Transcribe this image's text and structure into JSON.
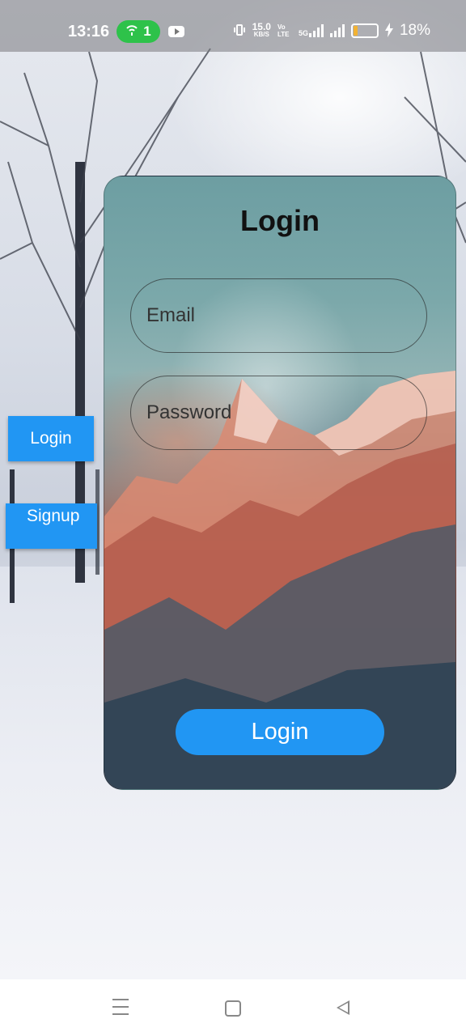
{
  "status_bar": {
    "time": "13:16",
    "hotspot_count": "1",
    "speed_value": "15.0",
    "speed_unit": "KB/S",
    "volte": "Vo LTE",
    "network": "5G",
    "battery_percent": "18%",
    "battery_level": 0.18
  },
  "side_buttons": {
    "login_label": "Login",
    "signup_label": "Signup"
  },
  "card": {
    "title": "Login",
    "email_placeholder": "Email",
    "password_placeholder": "Password",
    "submit_label": "Login"
  },
  "colors": {
    "accent": "#2196f3",
    "hotspot": "#2ec24a",
    "battery": "#f2b233"
  },
  "icons": [
    "hotspot-icon",
    "youtube-icon",
    "vibrate-icon",
    "signal-icon",
    "battery-icon",
    "charging-icon",
    "menu-icon",
    "home-icon",
    "back-icon"
  ]
}
